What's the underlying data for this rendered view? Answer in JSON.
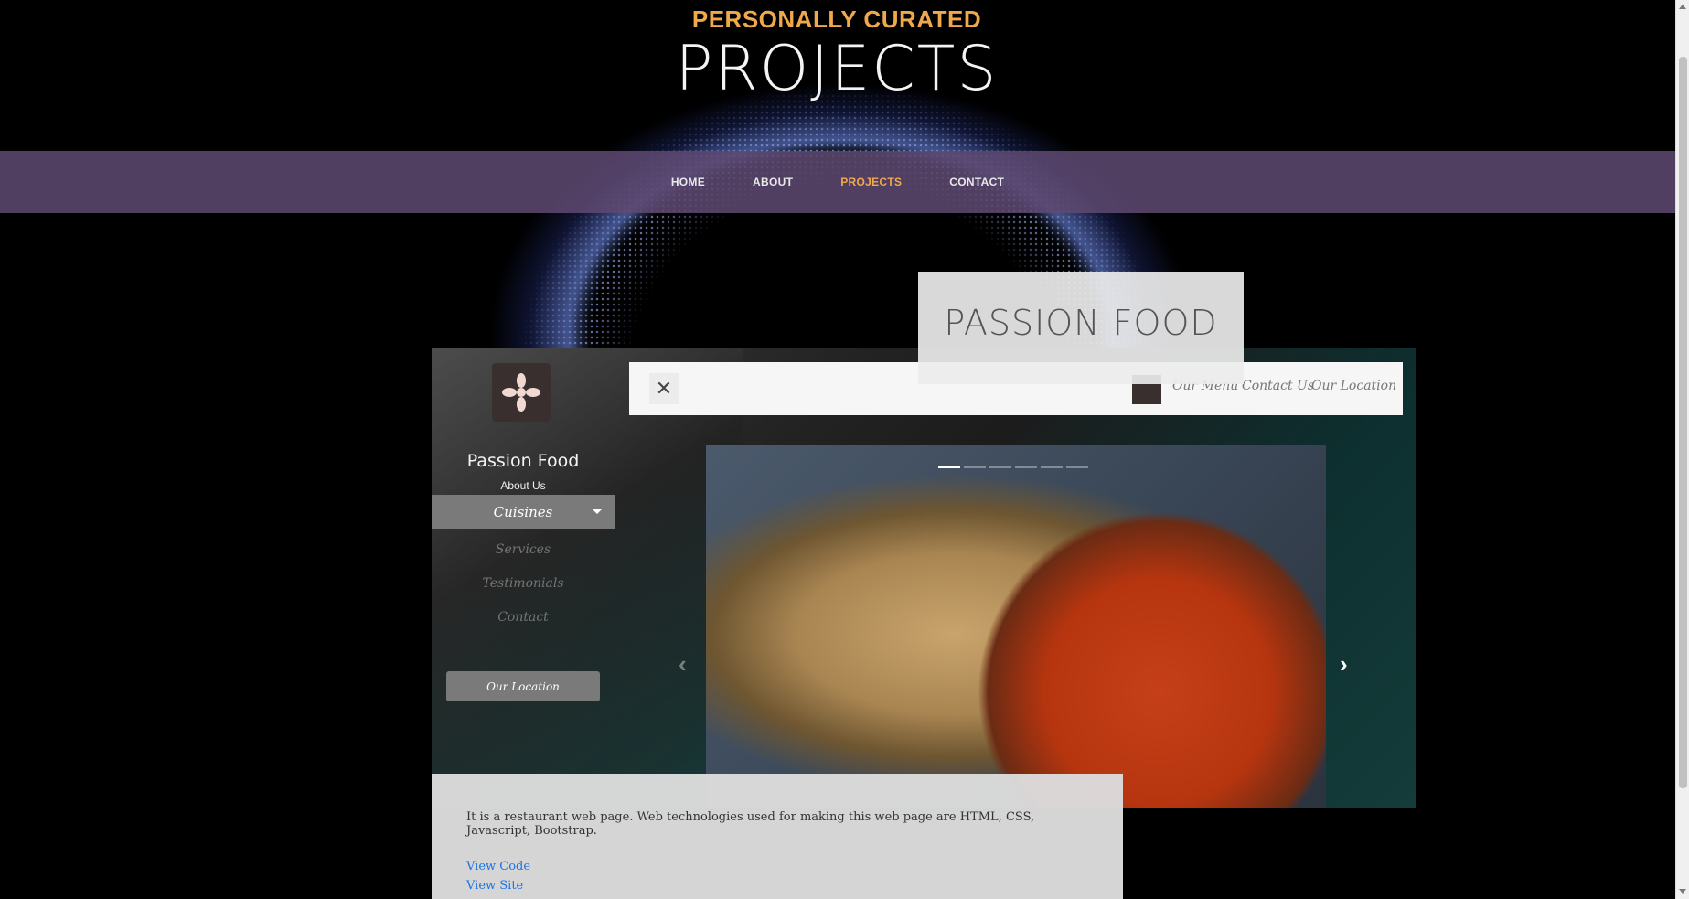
{
  "header": {
    "kicker": "PERSONALLY CURATED",
    "title": "PROJECTS"
  },
  "nav": {
    "items": [
      {
        "label": "HOME",
        "active": false
      },
      {
        "label": "ABOUT",
        "active": false
      },
      {
        "label": "PROJECTS",
        "active": true
      },
      {
        "label": "CONTACT",
        "active": false
      }
    ]
  },
  "project": {
    "headline": "PASSION FOOD",
    "description": "It is a restaurant web page. Web technologies used for making this web page are HTML, CSS, Javascript, Bootstrap.",
    "view_code": "View Code",
    "view_site": "View Site"
  },
  "screenshot": {
    "brand": "Passion Food",
    "about": "About Us",
    "active_item": "Cuisines",
    "menu": [
      "Services",
      "Testimonials",
      "Contact"
    ],
    "location_button": "Our Location",
    "topbar_links": [
      "Our Menu",
      "Contact Us",
      "Our Location"
    ],
    "carousel_slides": 6,
    "carousel_active": 1
  },
  "colors": {
    "accent": "#f0a84c",
    "nav_bg": "#5c4870",
    "link": "#1a73e8"
  },
  "icons": {
    "close": "close-icon",
    "next": "chevron-right-icon",
    "prev": "chevron-left-icon",
    "dropdown": "caret-down-icon",
    "logo": "restaurant-logo-icon"
  }
}
